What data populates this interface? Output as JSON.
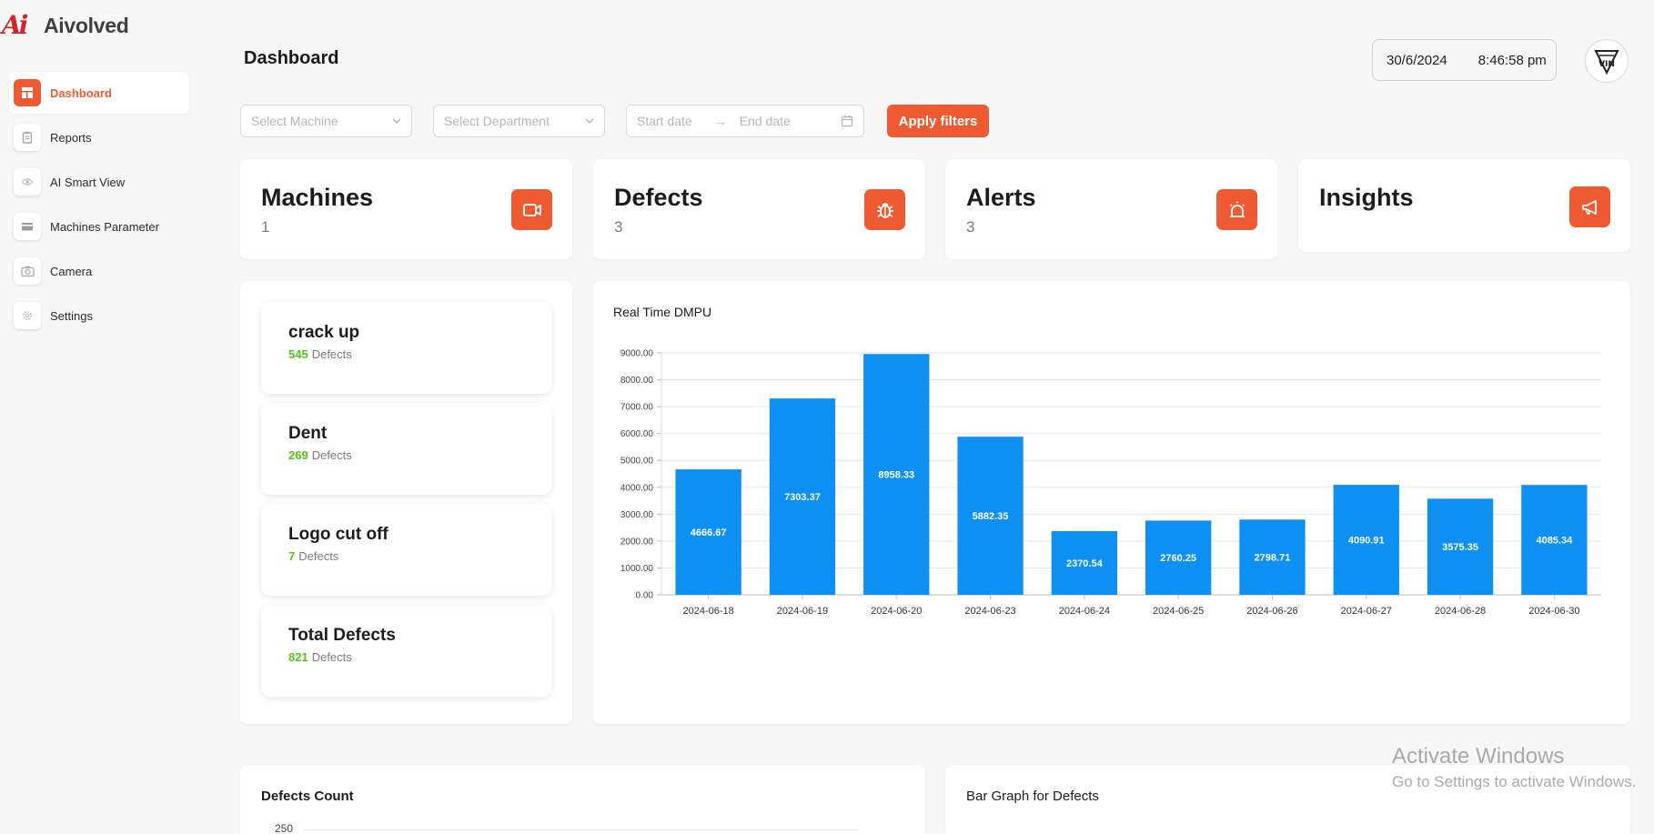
{
  "brand": {
    "logo_text": "Ai",
    "name": "Aivolved"
  },
  "sidebar": {
    "items": [
      {
        "label": "Dashboard",
        "icon": "dashboard-icon",
        "active": true
      },
      {
        "label": "Reports",
        "icon": "clipboard-icon"
      },
      {
        "label": "AI Smart View",
        "icon": "eye-icon"
      },
      {
        "label": "Machines Parameter",
        "icon": "card-icon"
      },
      {
        "label": "Camera",
        "icon": "camera-icon"
      },
      {
        "label": "Settings",
        "icon": "gear-icon"
      }
    ]
  },
  "header": {
    "title": "Dashboard",
    "date": "30/6/2024",
    "time": "8:46:58 pm",
    "avatar_text": "VIN"
  },
  "filters": {
    "machine_placeholder": "Select Machine",
    "department_placeholder": "Select Department",
    "start_placeholder": "Start date",
    "arrow": "→",
    "end_placeholder": "End date",
    "apply_label": "Apply filters"
  },
  "stats": [
    {
      "title": "Machines",
      "value": "1",
      "icon": "video-camera-icon"
    },
    {
      "title": "Defects",
      "value": "3",
      "icon": "bug-icon"
    },
    {
      "title": "Alerts",
      "value": "3",
      "icon": "alarm-icon"
    },
    {
      "title": "Insights",
      "value": "",
      "icon": "megaphone-icon"
    }
  ],
  "defects": [
    {
      "name": "crack up",
      "count": "545",
      "unit": "Defects"
    },
    {
      "name": "Dent",
      "count": "269",
      "unit": "Defects"
    },
    {
      "name": "Logo cut off",
      "count": "7",
      "unit": "Defects"
    },
    {
      "name": "Total Defects",
      "count": "821",
      "unit": "Defects"
    }
  ],
  "accent_color": "#ee5a31",
  "bar_color": "#0e8ff2",
  "count_color": "#52c41a",
  "chart_data": {
    "type": "bar",
    "title": "Real Time DMPU",
    "categories": [
      "2024-06-18",
      "2024-06-19",
      "2024-06-20",
      "2024-06-23",
      "2024-06-24",
      "2024-06-25",
      "2024-06-26",
      "2024-06-27",
      "2024-06-28",
      "2024-06-30"
    ],
    "values": [
      4666.67,
      7303.37,
      8958.33,
      5882.35,
      2370.54,
      2760.25,
      2798.71,
      4090.91,
      3575.35,
      4085.34
    ],
    "ylim": [
      0,
      9000
    ],
    "yticks": [
      "0.00",
      "1000.00",
      "2000.00",
      "3000.00",
      "4000.00",
      "5000.00",
      "6000.00",
      "7000.00",
      "8000.00",
      "9000.00"
    ],
    "grid": true,
    "legend": false
  },
  "bottom": {
    "left_title": "Defects Count",
    "left_first_tick": "250",
    "right_title": "Bar Graph for Defects"
  },
  "watermark": {
    "line1": "Activate Windows",
    "line2": "Go to Settings to activate Windows."
  }
}
